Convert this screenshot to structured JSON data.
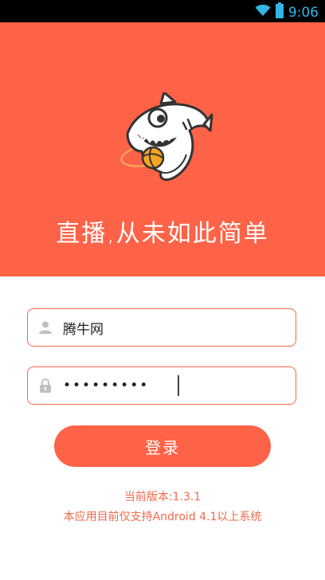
{
  "status_bar": {
    "time": "9:06",
    "wifi_icon": "wifi-icon",
    "battery_icon": "battery-icon"
  },
  "hero": {
    "slogan": "直播,从未如此简单",
    "mascot_icon": "shark-mascot-icon",
    "background": "#fe6247"
  },
  "login_form": {
    "username_value": "腾牛网",
    "username_icon": "user-icon",
    "password_value": "•••••••••",
    "password_icon": "lock-icon",
    "login_label": "登录"
  },
  "footer": {
    "version": "当前版本:1.3.1",
    "support": "本应用目前仅支持Android 4.1以上系统"
  },
  "colors": {
    "accent": "#fe6247",
    "border": "#f4684c",
    "status_accent": "#33b5e5"
  }
}
